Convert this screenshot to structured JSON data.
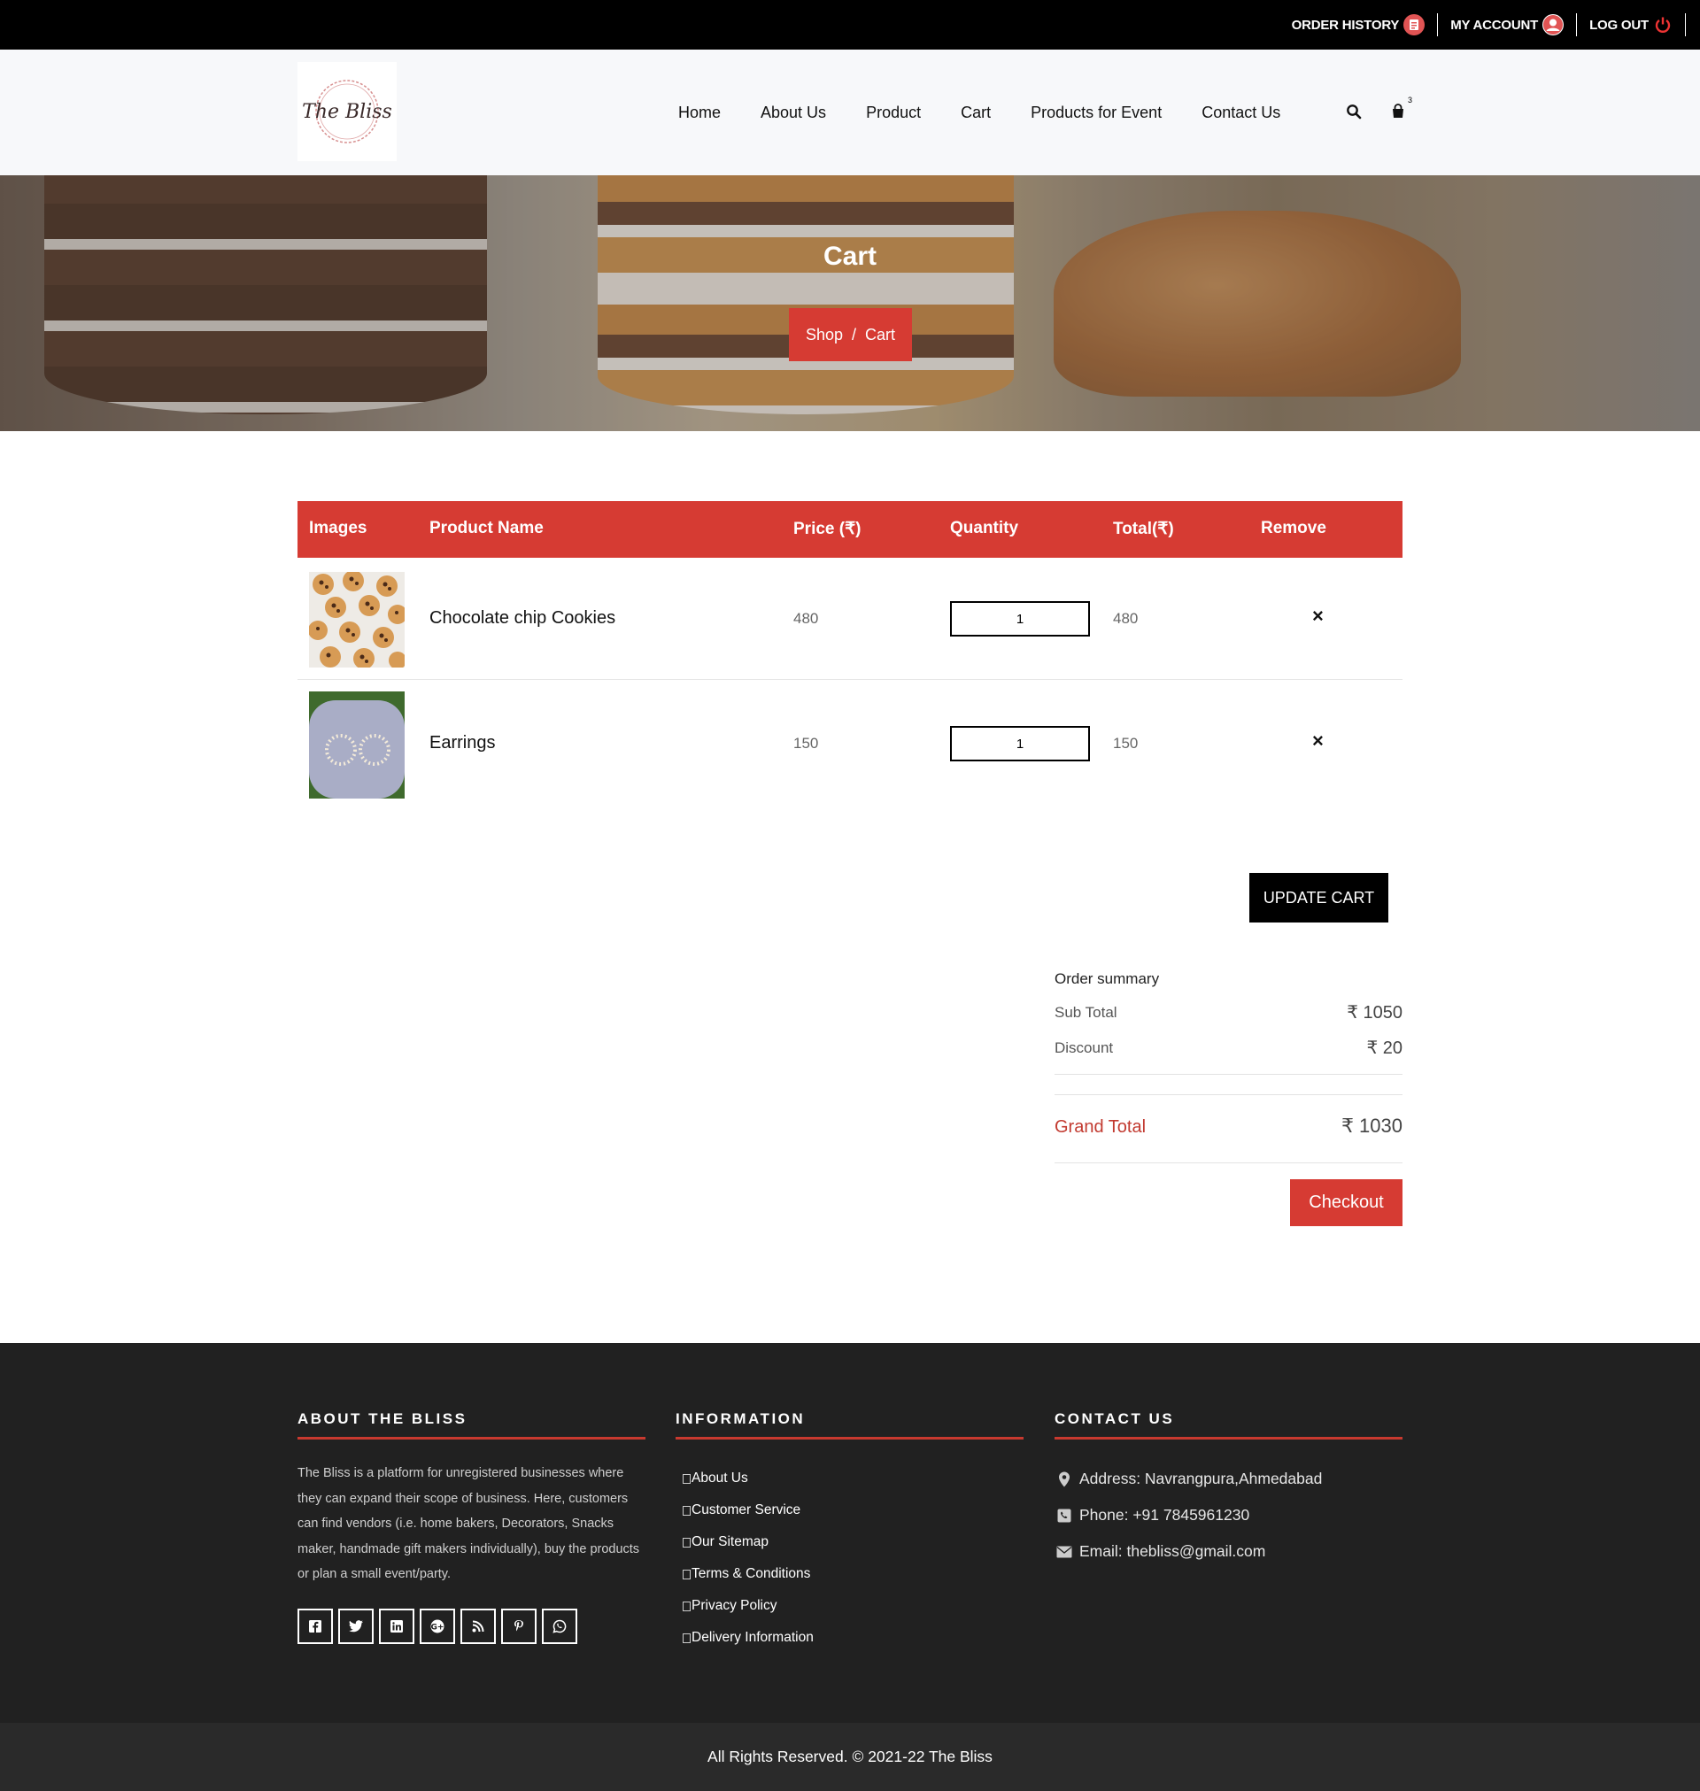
{
  "topbar": {
    "order_history": "ORDER HISTORY",
    "my_account": "MY ACCOUNT",
    "log_out": "LOG OUT"
  },
  "brand": {
    "logo_text": "The Bliss"
  },
  "nav": {
    "items": [
      "Home",
      "About Us",
      "Product",
      "Cart",
      "Products for Event",
      "Contact Us"
    ],
    "cart_count": "3"
  },
  "hero": {
    "title": "Cart",
    "breadcrumb": [
      "Shop",
      "Cart"
    ],
    "separator": "/"
  },
  "cart": {
    "headers": {
      "images": "Images",
      "product_name": "Product Name",
      "price": "Price (₹)",
      "quantity": "Quantity",
      "total": "Total(₹)",
      "remove": "Remove"
    },
    "items": [
      {
        "name": "Chocolate chip Cookies",
        "price": "480",
        "quantity": "1",
        "total": "480",
        "remove": "×",
        "image": "cookies-image"
      },
      {
        "name": "Earrings",
        "price": "150",
        "quantity": "1",
        "total": "150",
        "remove": "×",
        "image": "earrings-image"
      }
    ],
    "update_label": "UPDATE CART"
  },
  "summary": {
    "title": "Order summary",
    "subtotal_label": "Sub Total",
    "subtotal_value": "₹ 1050",
    "discount_label": "Discount",
    "discount_value": "₹ 20",
    "grand_label": "Grand Total",
    "grand_value": "₹ 1030",
    "checkout_label": "Checkout"
  },
  "footer": {
    "about": {
      "heading": "ABOUT THE BLISS",
      "text": "The Bliss is a platform for unregistered businesses where they can expand their scope of business. Here, customers can find vendors (i.e. home bakers, Decorators, Snacks maker, handmade gift makers individually), buy the products or plan a small event/party.",
      "socials": [
        "facebook-icon",
        "twitter-icon",
        "linkedin-icon",
        "google-plus-icon",
        "rss-icon",
        "pinterest-icon",
        "whatsapp-icon"
      ]
    },
    "information": {
      "heading": "INFORMATION",
      "links": [
        "About Us",
        "Customer Service",
        "Our Sitemap",
        "Terms & Conditions",
        "Privacy Policy",
        "Delivery Information"
      ]
    },
    "contact": {
      "heading": "CONTACT US",
      "address": "Address: Navrangpura,Ahmedabad",
      "phone": "Phone: +91 7845961230",
      "email": "Email: thebliss@gmail.com"
    },
    "copyright": "All Rights Reserved. © 2021-22 The Bliss"
  },
  "colors": {
    "accent": "#d63b33",
    "topbar": "#000000",
    "footer": "#212121"
  }
}
